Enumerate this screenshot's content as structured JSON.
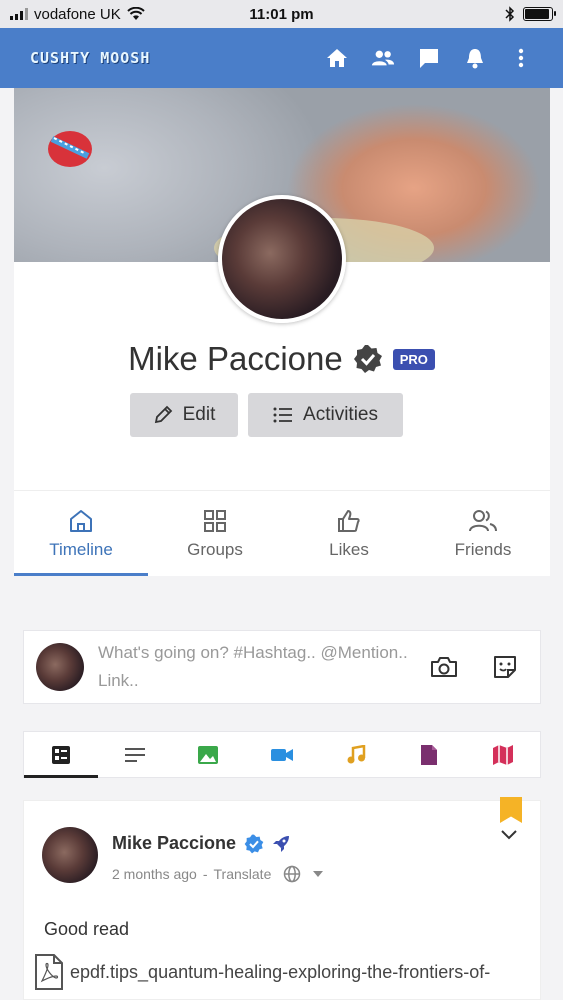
{
  "status_bar": {
    "carrier": "vodafone UK",
    "time": "11:01 pm"
  },
  "app": {
    "logo": "CUSHTY MOOSH"
  },
  "profile": {
    "name": "Mike Paccione",
    "badge": "PRO"
  },
  "actions": {
    "edit": "Edit",
    "activities": "Activities"
  },
  "tabs": [
    {
      "label": "Timeline",
      "icon": "home-icon"
    },
    {
      "label": "Groups",
      "icon": "grid-icon"
    },
    {
      "label": "Likes",
      "icon": "thumbs-up-icon"
    },
    {
      "label": "Friends",
      "icon": "users-icon"
    }
  ],
  "composer": {
    "placeholder": "What's going on? #Hashtag.. @Mention.. Link.."
  },
  "filters": [
    {
      "icon": "all-posts-icon",
      "color": "#222222"
    },
    {
      "icon": "text-icon",
      "color": "#555555"
    },
    {
      "icon": "image-icon",
      "color": "#3aa84a"
    },
    {
      "icon": "video-icon",
      "color": "#2a8fe0"
    },
    {
      "icon": "music-icon",
      "color": "#e0a020"
    },
    {
      "icon": "file-icon",
      "color": "#7a2f6e"
    },
    {
      "icon": "map-icon",
      "color": "#d4305a"
    }
  ],
  "post": {
    "author": "Mike Paccione",
    "time": "2 months ago",
    "translate": "Translate",
    "body": "Good read",
    "file": "epdf.tips_quantum-healing-exploring-the-frontiers-of-"
  },
  "colors": {
    "appbar": "#4a7ec9",
    "accent": "#3d73b8",
    "pro": "#3b4fb0",
    "bookmark": "#f5b326"
  }
}
